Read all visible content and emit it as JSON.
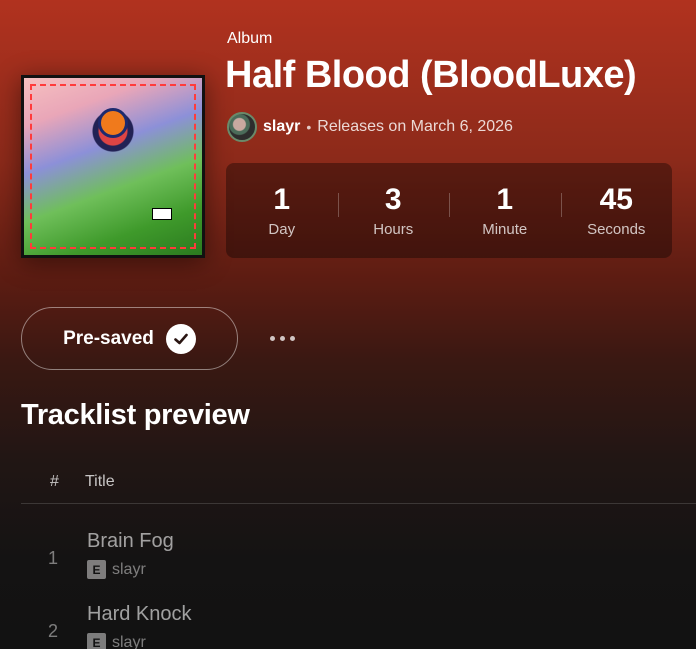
{
  "album": {
    "type_label": "Album",
    "title": "Half Blood (BloodLuxe)",
    "artist": "slayr",
    "release_text": "Releases on March 6, 2026"
  },
  "countdown": [
    {
      "value": "1",
      "unit": "Day"
    },
    {
      "value": "3",
      "unit": "Hours"
    },
    {
      "value": "1",
      "unit": "Minute"
    },
    {
      "value": "45",
      "unit": "Seconds"
    }
  ],
  "actions": {
    "presave_label": "Pre-saved",
    "presave_icon": "check-icon",
    "more_icon": "more-options-icon"
  },
  "tracklist": {
    "heading": "Tracklist preview",
    "col_number": "#",
    "col_title": "Title",
    "tracks": [
      {
        "number": "1",
        "title": "Brain Fog",
        "badge": "E",
        "artist": "slayr"
      },
      {
        "number": "2",
        "title": "Hard Knock",
        "badge": "E",
        "artist": "slayr"
      }
    ]
  },
  "colors": {
    "header_top": "#b1321f",
    "background": "#121212"
  }
}
